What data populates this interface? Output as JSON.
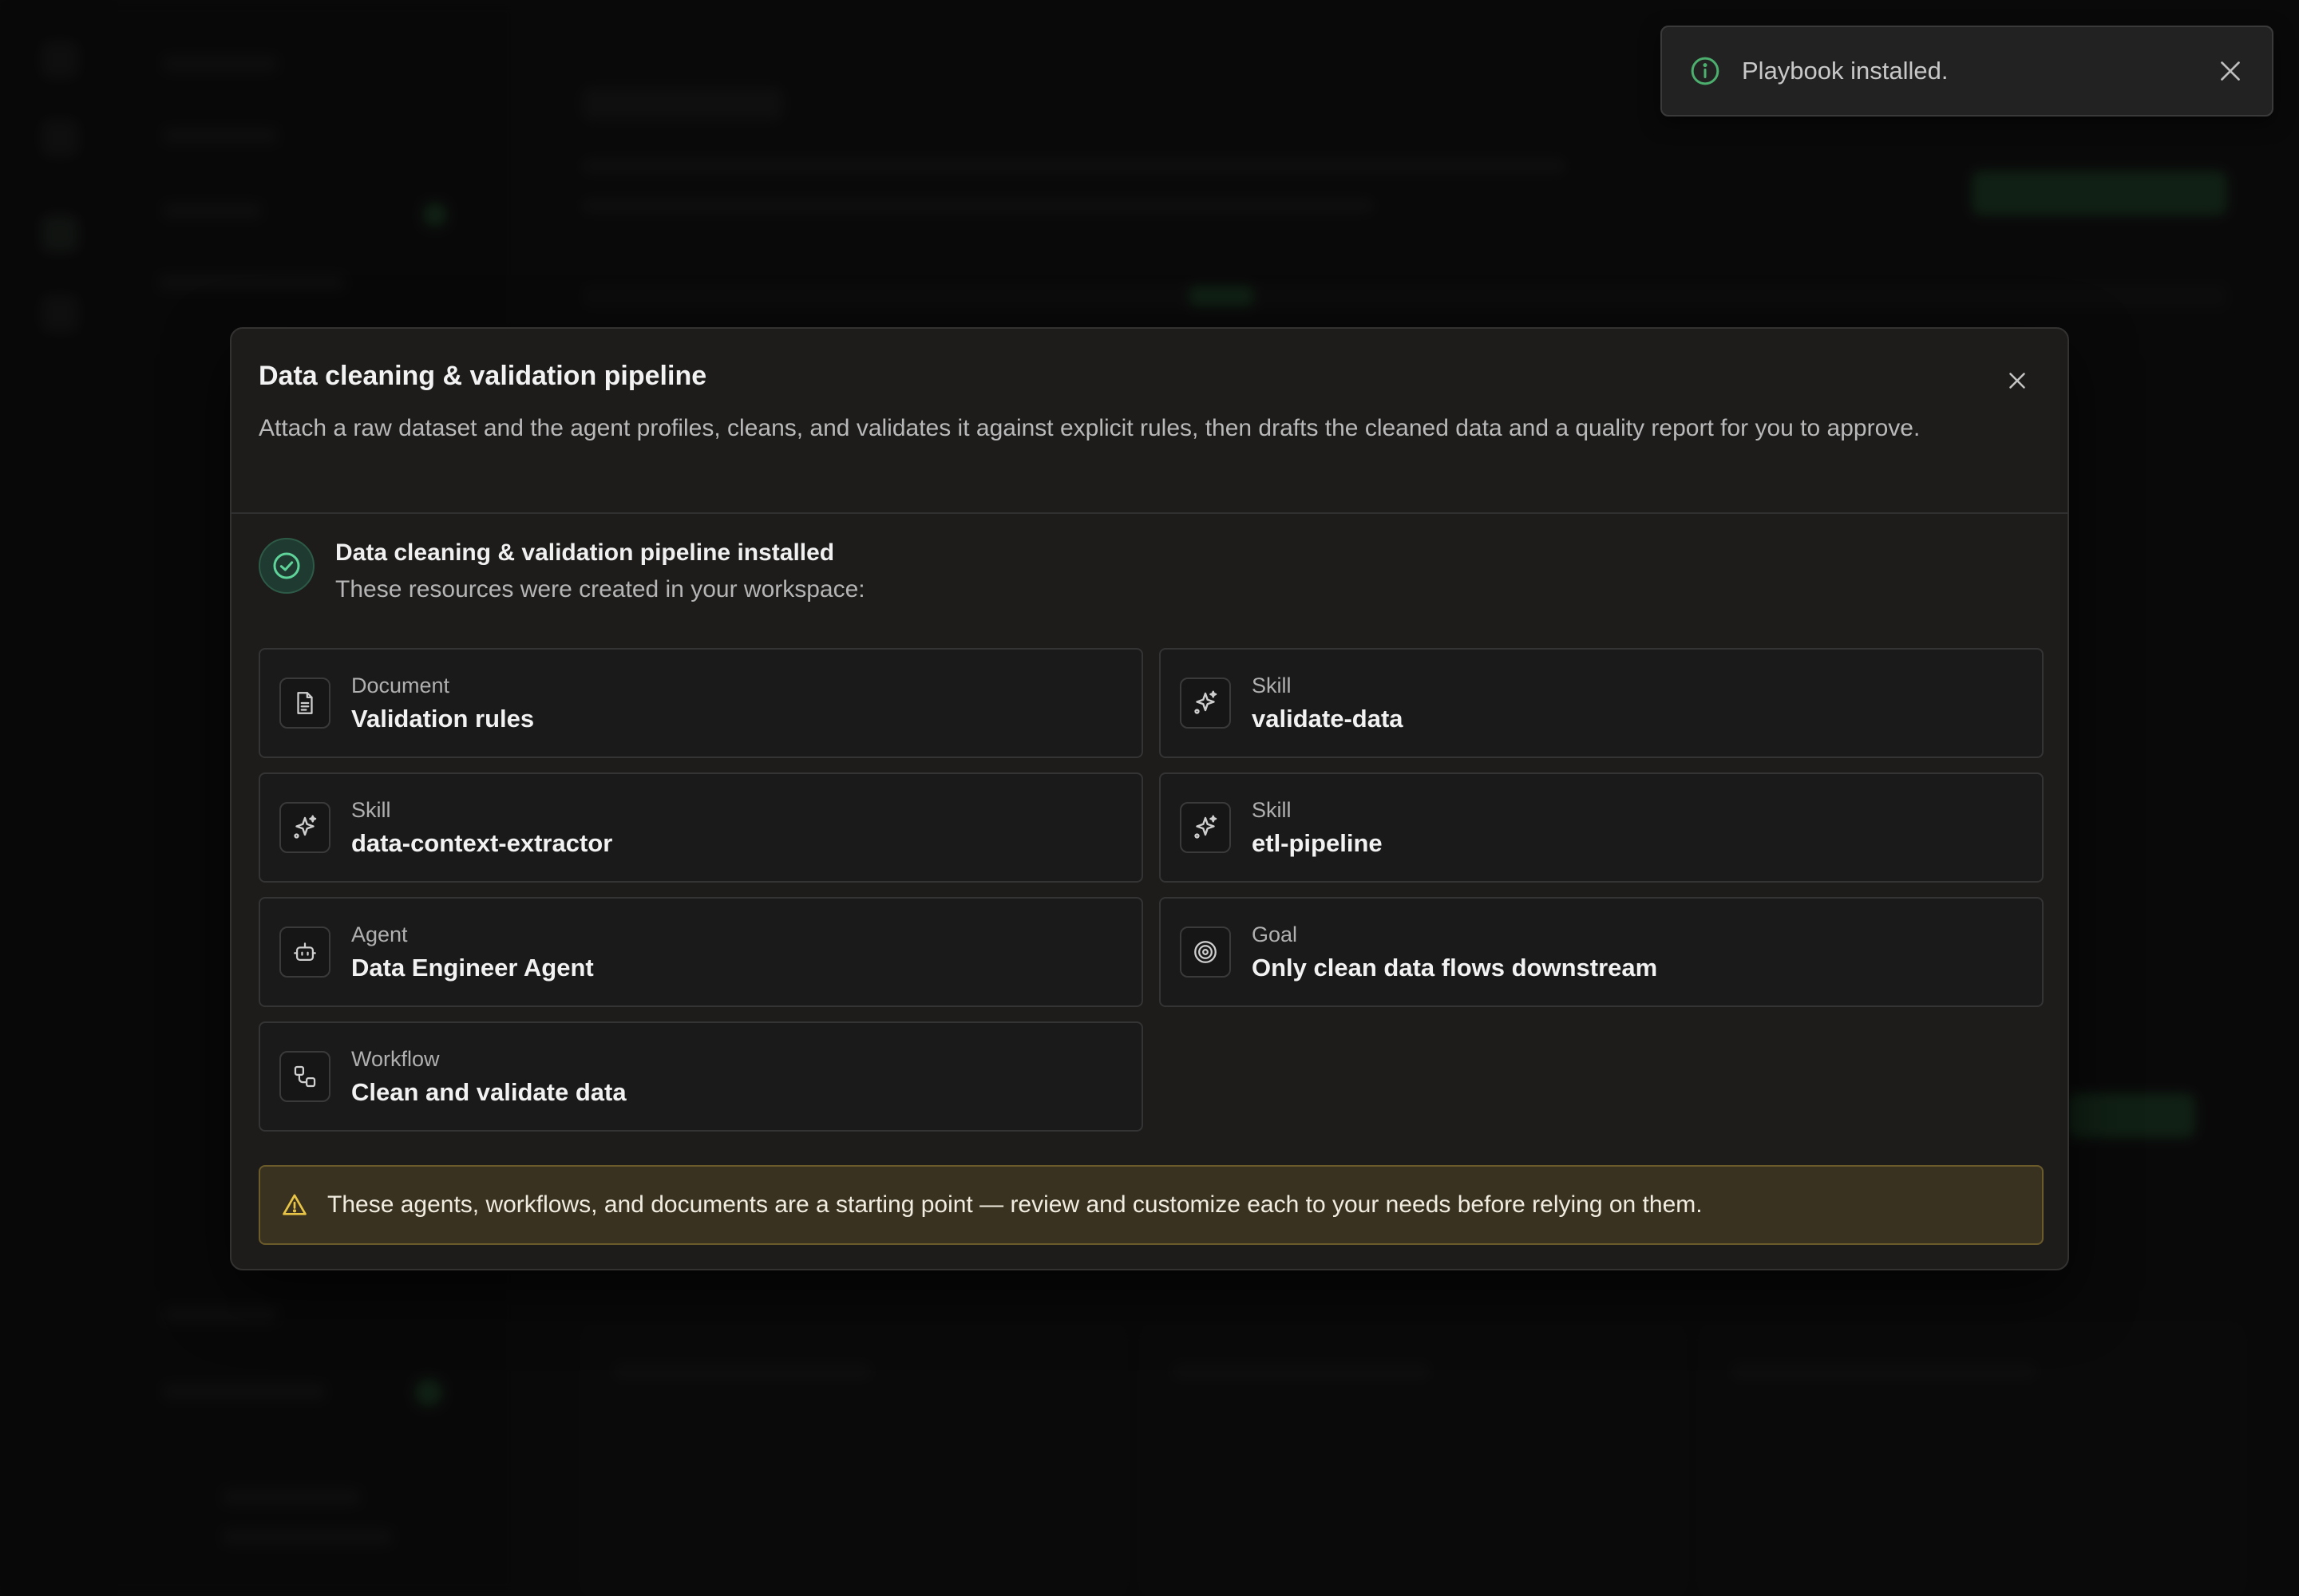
{
  "toast": {
    "message": "Playbook installed.",
    "icon": "info-icon",
    "accent": "#4caf6e"
  },
  "modal": {
    "title": "Data cleaning & validation pipeline",
    "description": "Attach a raw dataset and the agent profiles, cleans, and validates it against explicit rules, then drafts the cleaned data and a quality report for you to approve.",
    "success_title": "Data cleaning & validation pipeline installed",
    "success_subtitle": "These resources were created in your workspace:",
    "resources": [
      {
        "type": "Document",
        "name": "Validation rules",
        "icon": "document-icon"
      },
      {
        "type": "Skill",
        "name": "validate-data",
        "icon": "sparkles-icon"
      },
      {
        "type": "Skill",
        "name": "data-context-extractor",
        "icon": "sparkles-icon"
      },
      {
        "type": "Skill",
        "name": "etl-pipeline",
        "icon": "sparkles-icon"
      },
      {
        "type": "Agent",
        "name": "Data Engineer Agent",
        "icon": "bot-icon"
      },
      {
        "type": "Goal",
        "name": "Only clean data flows downstream",
        "icon": "target-icon"
      },
      {
        "type": "Workflow",
        "name": "Clean and validate data",
        "icon": "workflow-icon"
      }
    ],
    "warning": "These agents, workflows, and documents are a starting point — review and customize each to your needs before relying on them."
  },
  "colors": {
    "success": "#4caf6e",
    "warning_icon": "#e8c547",
    "warning_bg": "#3a3220"
  }
}
